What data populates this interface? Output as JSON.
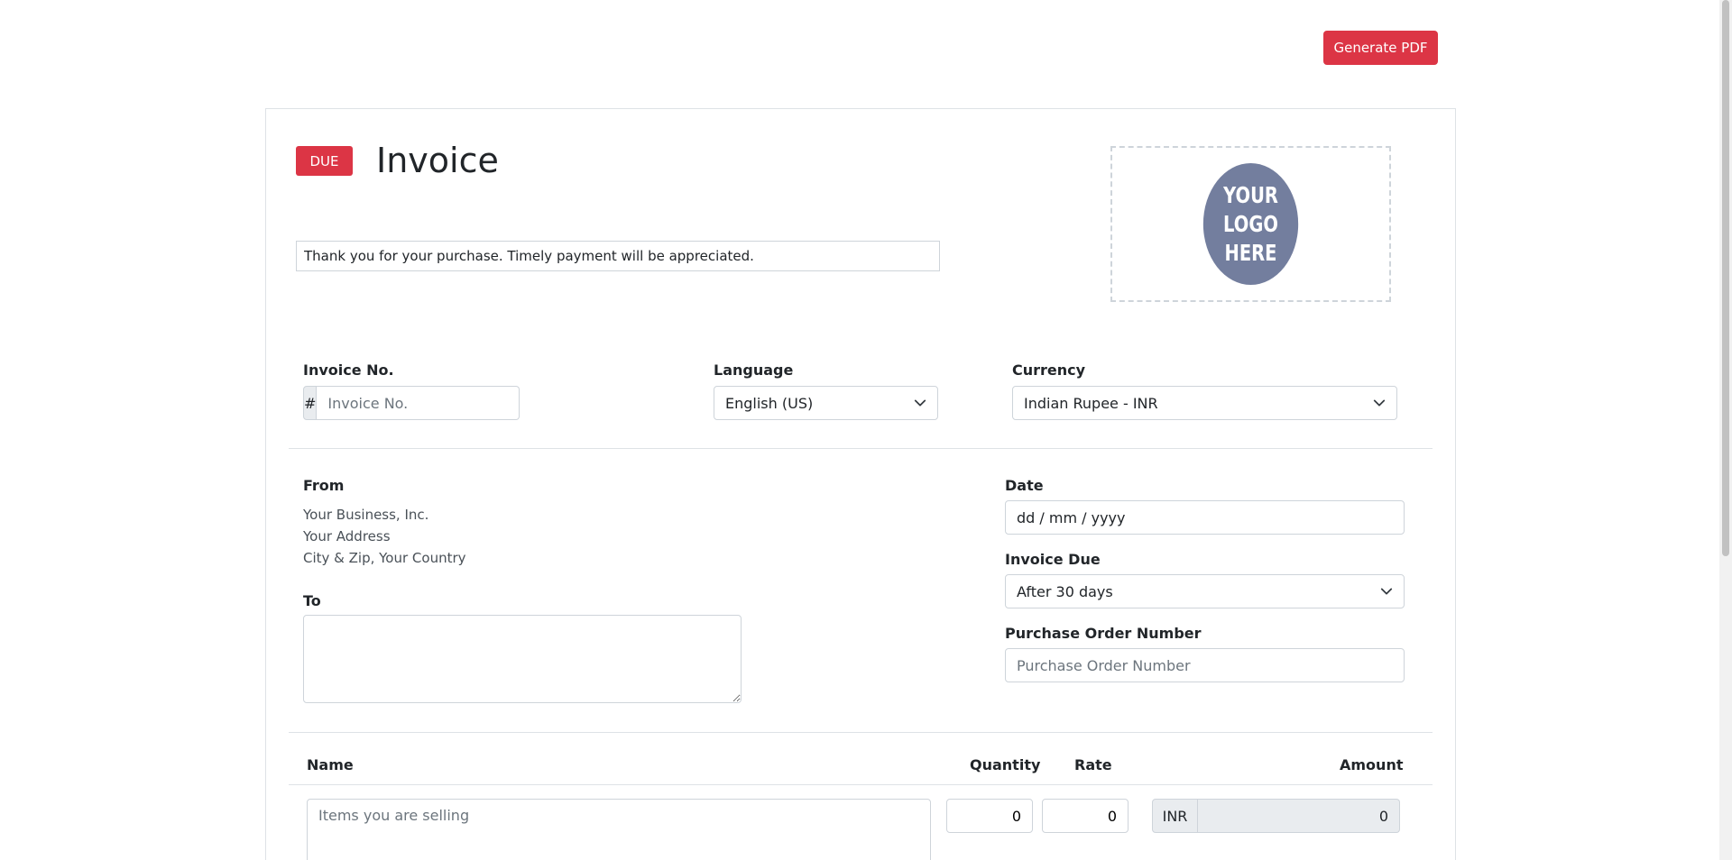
{
  "toolbar": {
    "generate_pdf_label": "Generate PDF"
  },
  "header": {
    "status_badge": "DUE",
    "title": "Invoice",
    "note_value": "Thank you for your purchase. Timely payment will be appreciated.",
    "logo_lines": [
      "YOUR",
      "LOGO",
      "HERE"
    ]
  },
  "invoice_no": {
    "label": "Invoice No.",
    "prefix": "#",
    "placeholder": "Invoice No."
  },
  "language": {
    "label": "Language",
    "selected": "English (US)"
  },
  "currency": {
    "label": "Currency",
    "selected": "Indian Rupee - INR"
  },
  "from": {
    "label": "From",
    "lines": [
      "Your Business, Inc.",
      "Your Address",
      "City & Zip, Your Country"
    ]
  },
  "to": {
    "label": "To"
  },
  "date": {
    "label": "Date",
    "placeholder": "dd / mm / yyyy"
  },
  "invoice_due": {
    "label": "Invoice Due",
    "selected": "After 30 days"
  },
  "po_number": {
    "label": "Purchase Order Number",
    "placeholder": "Purchase Order Number"
  },
  "items_table": {
    "columns": {
      "name": "Name",
      "quantity": "Quantity",
      "rate": "Rate",
      "amount": "Amount"
    },
    "rows": [
      {
        "name_placeholder": "Items you are selling",
        "quantity": "0",
        "rate": "0",
        "currency": "INR",
        "amount": "0"
      }
    ]
  },
  "colors": {
    "danger": "#dc3545",
    "border": "#ced4da",
    "logo_bg": "#737e9e"
  },
  "icons": {
    "select_chevron": "chevron-down-icon"
  }
}
